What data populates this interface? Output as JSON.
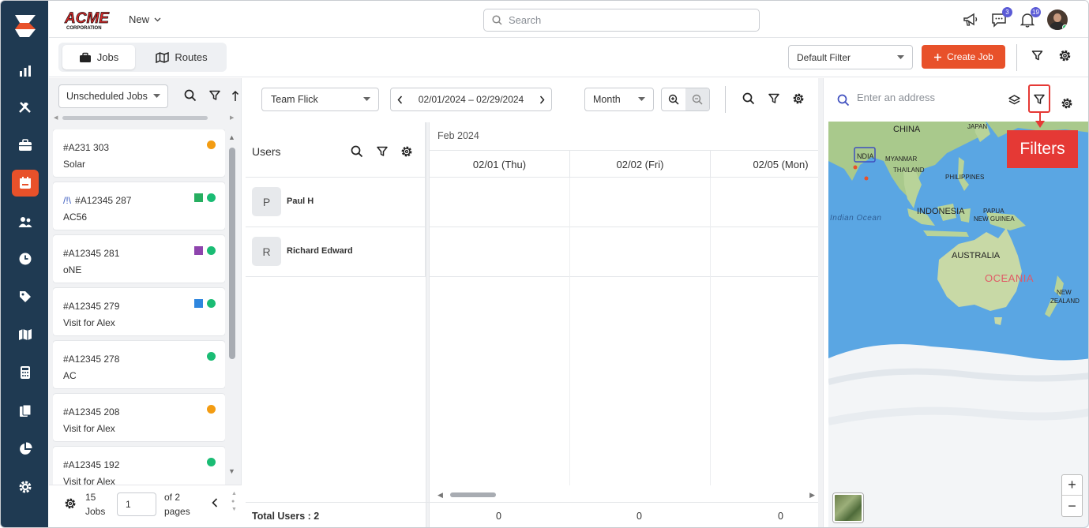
{
  "app": {
    "brand": "ACME",
    "brand_sub": "CORPORATION",
    "new_label": "New",
    "search_placeholder": "Search"
  },
  "notifications": {
    "chat_count": "3",
    "bell_count": "19"
  },
  "rail": {
    "items": [
      "logo-icon",
      "reports-icon",
      "tools-icon",
      "jobs-icon",
      "schedule-icon",
      "customers-icon",
      "timesheet-icon",
      "tags-icon",
      "map-icon",
      "calculator-icon",
      "documents-icon",
      "analytics-icon",
      "settings-icon"
    ],
    "active": "schedule-icon"
  },
  "subbar": {
    "tabs": [
      {
        "label": "Jobs",
        "active": true,
        "icon": "briefcase-icon"
      },
      {
        "label": "Routes",
        "active": false,
        "icon": "map-icon"
      }
    ],
    "default_filter": "Default Filter",
    "create_job": "Create Job"
  },
  "jobs_panel": {
    "filter": "Unscheduled Jobs",
    "jobs": [
      {
        "id": "#A231 303",
        "desc": "Solar",
        "marks": [
          "dot:#f39c12"
        ]
      },
      {
        "id": "#A12345 287",
        "prefix": "/!\\",
        "desc": "AC56",
        "marks": [
          "square:#27ae60",
          "dot:#1abc74"
        ]
      },
      {
        "id": "#A12345 281",
        "desc": "oNE",
        "marks": [
          "square:#8e44ad",
          "dot:#1abc74"
        ]
      },
      {
        "id": "#A12345 279",
        "desc": "Visit for Alex",
        "marks": [
          "square:#2e86de",
          "dot:#1abc74"
        ]
      },
      {
        "id": "#A12345 278",
        "desc": "AC",
        "marks": [
          "dot:#1abc74"
        ]
      },
      {
        "id": "#A12345 208",
        "desc": "Visit for Alex",
        "marks": [
          "dot:#f39c12"
        ]
      },
      {
        "id": "#A12345 192",
        "desc": "Visit for Alex",
        "marks": [
          "dot:#1abc74"
        ]
      }
    ],
    "footer": {
      "count": "15",
      "count_unit": "Jobs",
      "page": "1",
      "of_label": "of 2",
      "pages_label": "pages"
    }
  },
  "schedule": {
    "team": "Team Flick",
    "date_range": "02/01/2024 – 02/29/2024",
    "view": "Month",
    "users_title": "Users",
    "month_label": "Feb 2024",
    "days": [
      "02/01 (Thu)",
      "02/02 (Fri)",
      "02/05 (Mon)"
    ],
    "users": [
      {
        "initial": "P",
        "name": "Paul H"
      },
      {
        "initial": "R",
        "name": "Richard Edward"
      }
    ],
    "total_label": "Total Users : 2",
    "totals": [
      "0",
      "0",
      "0"
    ]
  },
  "map": {
    "placeholder": "Enter an address",
    "labels": {
      "china": "CHINA",
      "japan": "JAPAN",
      "india": "NDIA",
      "myanmar": "MYANMAR",
      "thailand": "THAILAND",
      "philippines": "PHILIPPINES",
      "indian_ocean": "Indian Ocean",
      "indonesia": "INDONESIA",
      "papua1": "PAPUA",
      "papua2": "NEW GUINEA",
      "australia": "AUSTRALIA",
      "oceania": "OCEANIA",
      "nz1": "NEW",
      "nz2": "ZEALAND"
    },
    "zoom_in": "+",
    "zoom_out": "−"
  },
  "callout": {
    "label": "Filters",
    "color": "#e53935"
  },
  "colors": {
    "accent": "#e8512a",
    "rail": "#1f3a52",
    "badge": "#5b5bd6"
  }
}
